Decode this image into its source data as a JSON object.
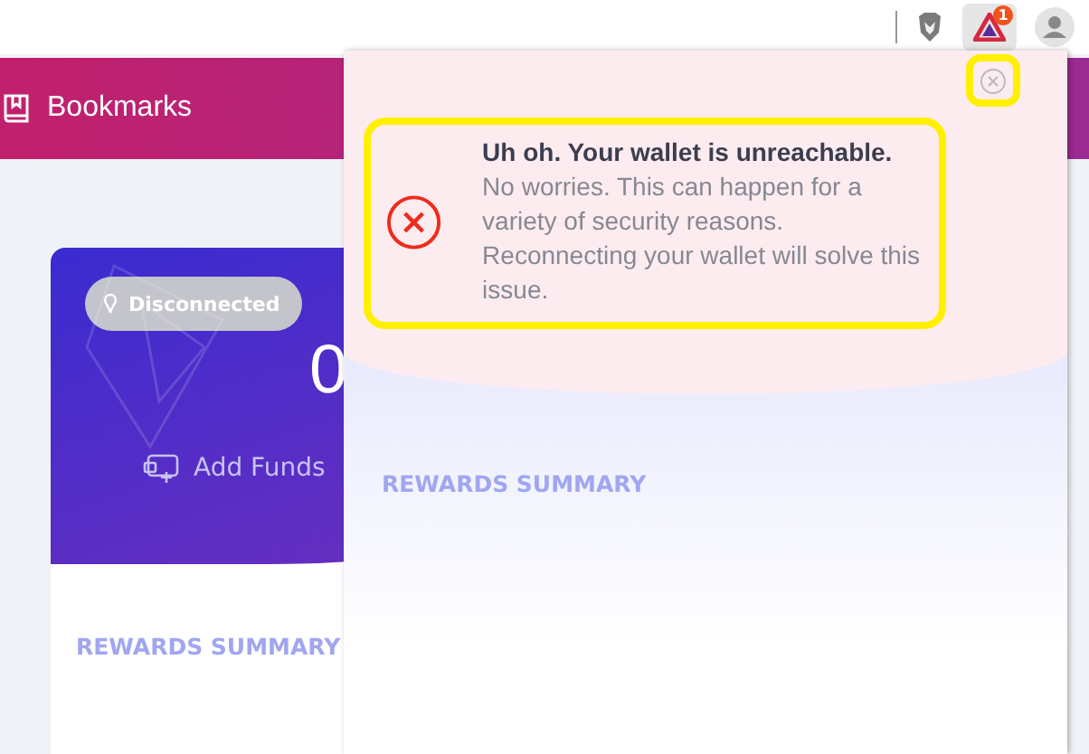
{
  "toolbar": {
    "notification_count": "1"
  },
  "header": {
    "title": "Bookmarks"
  },
  "wallet_card": {
    "status": "Disconnected",
    "balance": "0",
    "add_funds": "Add Funds",
    "section_title": "REWARDS SUMMARY"
  },
  "popup": {
    "alert": {
      "title": "Uh oh. Your wallet is unreachable.",
      "message": "No worries. This can happen for a variety of security reasons. Reconnecting your wallet will solve this issue."
    },
    "section_title": "REWARDS SUMMARY"
  }
}
